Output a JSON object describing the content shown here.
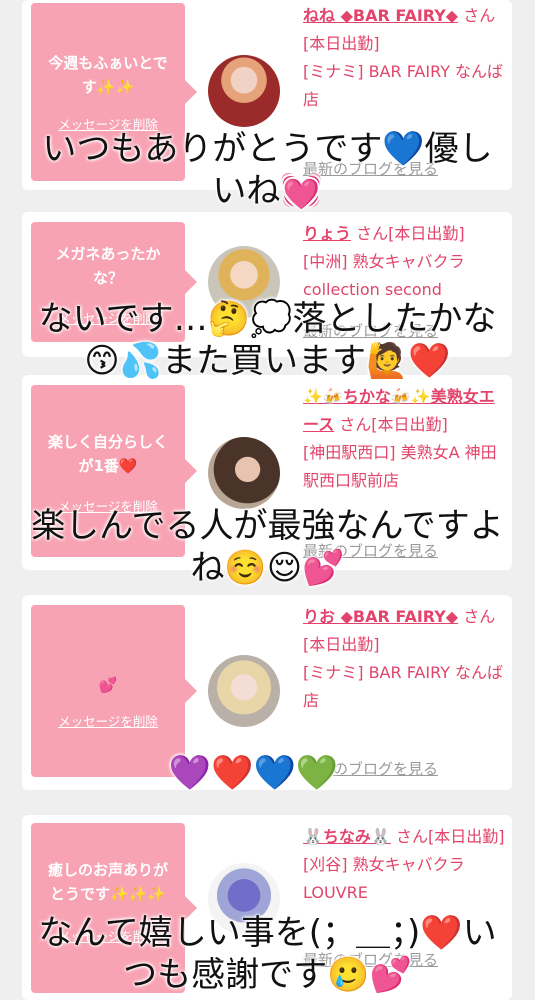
{
  "delete_label": "メッセージを削除",
  "blog_label": "最新のブログを見る",
  "cards": [
    {
      "message": "今週もふぁいとです✨✨",
      "cast_name": "ねね ◆BAR FAIRY◆",
      "san": "さん[本日出勤]",
      "shop": "[ミナミ] BAR FAIRY なんば店",
      "avatar": "avatar-woman-red-hair"
    },
    {
      "message": "メガネあったかな？",
      "cast_name": "りょう",
      "san": "さん[本日出勤]",
      "shop": "[中洲] 熟女キャバクラ collection second",
      "avatar": "avatar-woman-blonde"
    },
    {
      "message": "楽しく自分らしくが1番❤️",
      "cast_name": "✨🍻ちかな🍻✨美熟女エース",
      "san": "さん[本日出勤]",
      "shop": "[神田駅西口] 美熟女A 神田駅西口駅前店",
      "avatar": "avatar-woman-dark-hair"
    },
    {
      "message": "💕",
      "cast_name": "りお ◆BAR FAIRY◆",
      "san": "さん[本日出勤]",
      "shop": "[ミナミ] BAR FAIRY なんば店",
      "avatar": "avatar-woman-doll"
    },
    {
      "message": "癒しのお声ありがとうです✨✨✨",
      "cast_name": "🐰ちなみ🐰",
      "san": "さん[本日出勤]",
      "shop": "[刈谷] 熟女キャバクラ LOUVRE",
      "avatar": "avatar-flower"
    }
  ],
  "overlays": [
    {
      "line1": "いつもありがとうです💙優し",
      "line2": "いね💓"
    },
    {
      "line1": "ないです…🤔💭落としたかな",
      "line2": "😙💦また買います🙋❤️"
    },
    {
      "line1": "楽しんでる人が最強なんですよ",
      "line2": "ね☺️😌💕"
    },
    {
      "line1": "💜❤️💙💚",
      "line2": ""
    },
    {
      "line1": "なんて嬉しい事を(；＿；)❤️い",
      "line2": "つも感謝です🥲💕"
    }
  ],
  "colors": {
    "background": "#efefef",
    "bubble": "#f8a3b3",
    "accent": "#e3446b",
    "muted": "#9a9a9a"
  }
}
